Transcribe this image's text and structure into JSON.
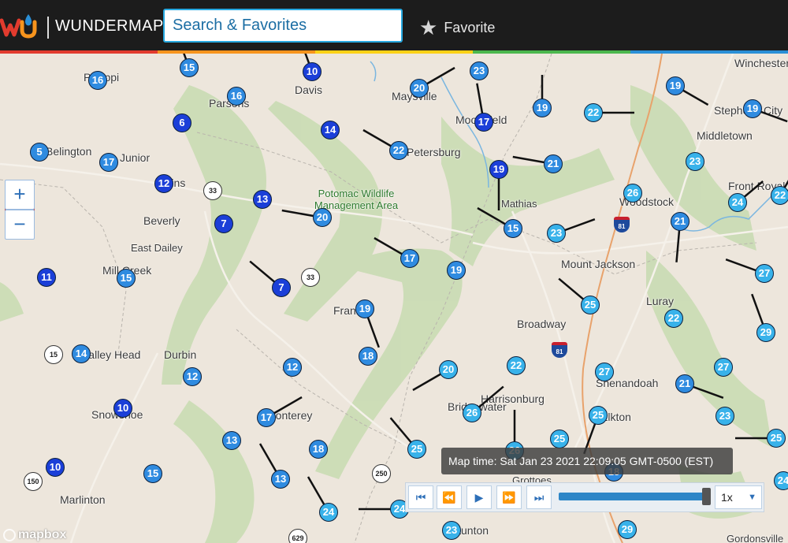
{
  "header": {
    "brand": "WUNDERMAP",
    "search_placeholder": "Search & Favorites",
    "favorite_label": "Favorite"
  },
  "map": {
    "places": [
      "Philippi",
      "Parsons",
      "Davis",
      "Maysville",
      "Moorefield",
      "Winchester",
      "Stephens City",
      "Middletown",
      "Junior",
      "Elkins",
      "Beverly",
      "East Dailey",
      "Mill Creek",
      "Petersburg",
      "Potomac Wildlife Management Area",
      "Mathias",
      "Woodstock",
      "Front Royal",
      "Mount Jackson",
      "Luray",
      "Franklin",
      "Broadway",
      "Valley Head",
      "Durbin",
      "Monterey",
      "Harrisonburg",
      "Shenandoah",
      "Bridgewater",
      "Elkton",
      "Grottoes",
      "Snowshoe",
      "Marlinton",
      "Staunton",
      "Gordonsville",
      "Belington"
    ],
    "route_shields": [
      "33",
      "33",
      "15",
      "150",
      "250",
      "629"
    ],
    "interstate_shields": [
      "81",
      "81"
    ],
    "stations": [
      "15",
      "16",
      "16",
      "10",
      "20",
      "23",
      "19",
      "19",
      "6",
      "14",
      "17",
      "19",
      "22",
      "5",
      "17",
      "12",
      "13",
      "22",
      "19",
      "21",
      "23",
      "24",
      "22",
      "7",
      "20",
      "26",
      "21",
      "27",
      "15",
      "23",
      "17",
      "11",
      "15",
      "7",
      "19",
      "25",
      "22",
      "19",
      "18",
      "29",
      "12",
      "14",
      "20",
      "22",
      "27",
      "27",
      "12",
      "17",
      "26",
      "21",
      "10",
      "26",
      "25",
      "25",
      "23",
      "25",
      "13",
      "18",
      "25",
      "13",
      "24",
      "10",
      "15",
      "16",
      "24",
      "24",
      "23",
      "29",
      "18"
    ],
    "attribution": "mapbox"
  },
  "controls": {
    "zoom_in": "+",
    "zoom_out": "−"
  },
  "player": {
    "map_time": "Map time: Sat Jan 23 2021 22:09:05 GMT-0500 (EST)",
    "speed": "1x"
  },
  "colors": {
    "top_bar": "#1c1c1c",
    "search_border": "#27a8e0",
    "station_dark": "#1b3fd8",
    "station_mid": "#2f8be0",
    "station_light": "#38b2ea",
    "forest": "#c9dcb3"
  }
}
